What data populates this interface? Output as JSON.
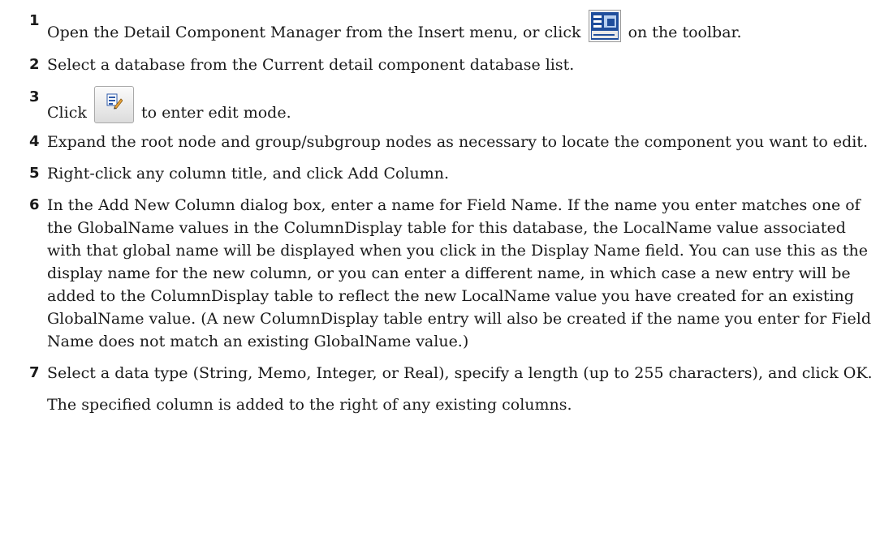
{
  "steps": [
    {
      "number": "1",
      "text_before": "Open the Detail Component Manager from the Insert menu, or click",
      "icon": "detail-component-manager-icon",
      "text_after": "on the toolbar."
    },
    {
      "number": "2",
      "text": "Select a database from the Current detail component database list."
    },
    {
      "number": "3",
      "text_before": "Click",
      "icon": "edit-mode-icon",
      "text_after": "to enter edit mode."
    },
    {
      "number": "4",
      "text": "Expand the root node and group/subgroup nodes as necessary to locate the component you want to edit."
    },
    {
      "number": "5",
      "text": "Right-click any column title, and click Add Column."
    },
    {
      "number": "6",
      "text": "In the Add New Column dialog box, enter a name for Field Name. If the name you enter matches one of the GlobalName values in the ColumnDisplay table for this database, the LocalName value associated with that global name will be displayed when you click in the Display Name field. You can use this as the display name for the new column, or you can enter a different name, in which case a new entry will be added to the ColumnDisplay table to reflect the new LocalName value you have created for an existing GlobalName value. (A new ColumnDisplay table entry will also be created if the name you enter for Field Name does not match an existing GlobalName value.)"
    },
    {
      "number": "7",
      "text": "Select a data type (String, Memo, Integer, or Real), specify a length (up to 255 characters), and click OK."
    }
  ],
  "result_note": "The specified column is added to the right of any existing columns.",
  "colors": {
    "text": "#1a1a1a",
    "icon_blue": "#1f4e9c"
  }
}
